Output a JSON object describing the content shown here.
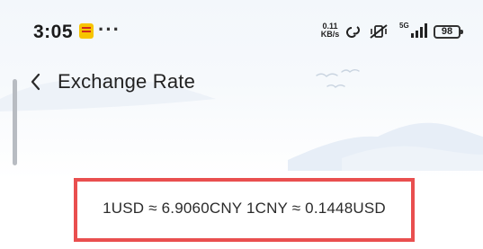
{
  "status_bar": {
    "time": "3:05",
    "more_indicator": "···",
    "net_speed_value": "0.11",
    "net_speed_unit": "KB/s",
    "network_type": "5G",
    "battery": "98"
  },
  "header": {
    "back_icon": "chevron-left-icon",
    "title": "Exchange Rate"
  },
  "rate": {
    "text": "1USD ≈ 6.9060CNY 1CNY ≈ 0.1448USD"
  },
  "colors": {
    "highlight_border": "#e94f4f",
    "background_top": "#f3f7fb",
    "mountain": "#e7eef7"
  },
  "icons": {
    "app_notification": "app-notification-icon",
    "link": "link-icon",
    "mute": "muted-vibrate-icon",
    "signal": "signal-icon",
    "battery": "battery-icon",
    "birds": "birds-icon"
  }
}
